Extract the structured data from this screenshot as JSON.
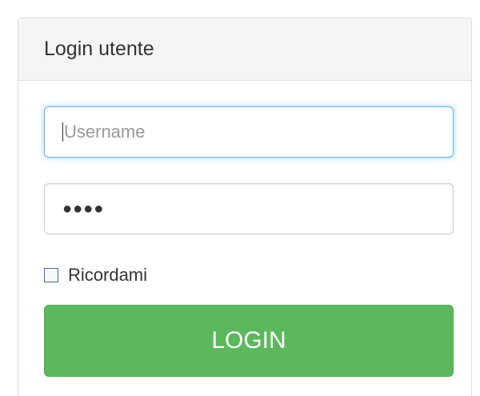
{
  "panel": {
    "title": "Login utente"
  },
  "form": {
    "username": {
      "placeholder": "Username",
      "value": ""
    },
    "password": {
      "masked_value": "●●●●"
    },
    "remember": {
      "label": "Ricordami",
      "checked": false
    },
    "login_button": {
      "label": "LOGIN"
    }
  },
  "colors": {
    "button_bg": "#5cb85c",
    "focus_border": "#66afe9",
    "heading_bg": "#f5f5f5"
  }
}
